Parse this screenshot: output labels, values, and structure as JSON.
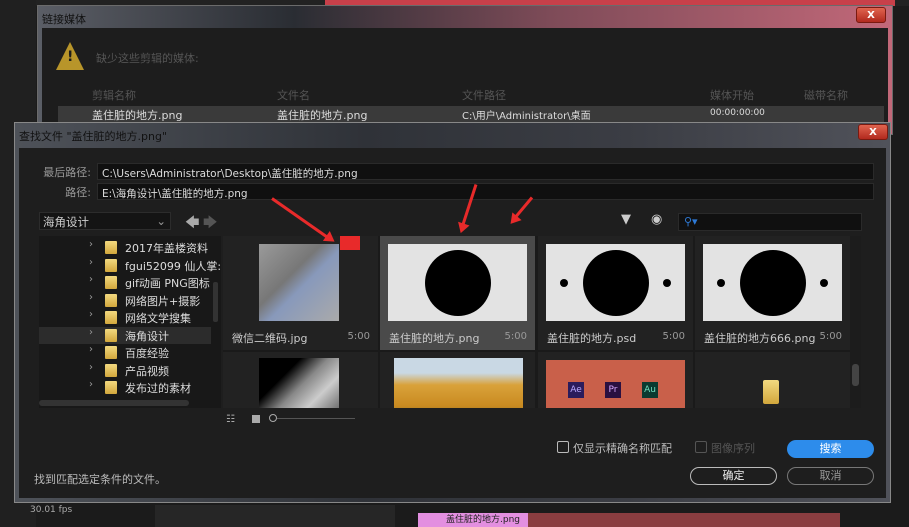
{
  "background": {
    "fps": "30.01 fps",
    "clip_name": "盖住脏的地方.png"
  },
  "link_media": {
    "title": "链接媒体",
    "close": "X",
    "message": "缺少这些剪辑的媒体:",
    "columns": [
      "剪辑名称",
      "文件名",
      "文件路径",
      "媒体开始",
      "磁带名称"
    ],
    "row": {
      "clip_name": "盖住脏的地方.png",
      "file_name": "盖住脏的地方.png",
      "path": "C:\\用户\\Administrator\\桌面",
      "media_start": "00:00:00:00",
      "tape": ""
    }
  },
  "find_file": {
    "title": "查找文件 \"盖住脏的地方.png\"",
    "close": "X",
    "last_path_label": "最后路径:",
    "last_path": "C:\\Users\\Administrator\\Desktop\\盖住脏的地方.png",
    "path_label": "路径:",
    "path": "E:\\海角设计\\盖住脏的地方.png",
    "location": "海角设计",
    "folders": [
      {
        "label": "2017年盖楼资料"
      },
      {
        "label": "fgui52099 仙人掌:"
      },
      {
        "label": "gif动画 PNG图标"
      },
      {
        "label": "网络图片+摄影"
      },
      {
        "label": "网络文学搜集"
      },
      {
        "label": "海角设计",
        "selected": true
      },
      {
        "label": "百度经验"
      },
      {
        "label": "产品视频"
      },
      {
        "label": "发布过的素材"
      }
    ],
    "files": [
      {
        "name": "微信二维码.jpg",
        "duration": "5:00",
        "thumb": "blurred"
      },
      {
        "name": "盖住脏的地方.png",
        "duration": "5:00",
        "thumb": "circle",
        "selected": true
      },
      {
        "name": "盖住脏的地方.psd",
        "duration": "5:00",
        "thumb": "circle-dots"
      },
      {
        "name": "盖住脏的地方666.png",
        "duration": "5:00",
        "thumb": "circle-dots"
      },
      {
        "name": "",
        "duration": "",
        "thumb": "blurred"
      },
      {
        "name": "",
        "duration": "",
        "thumb": "photo"
      },
      {
        "name": "",
        "duration": "",
        "thumb": "adobe",
        "badges": [
          "Ae",
          "Pr",
          "Au"
        ]
      },
      {
        "name": "",
        "duration": "",
        "thumb": "folder"
      }
    ],
    "exact_match_label": "仅显示精确名称匹配",
    "exact_match_checked": false,
    "image_sequence_label": "图像序列",
    "image_sequence_checked": false,
    "search_button": "搜索",
    "ok_button": "确定",
    "cancel_button": "取消",
    "status": "找到匹配选定条件的文件。",
    "accent": "#2d8ceb"
  }
}
